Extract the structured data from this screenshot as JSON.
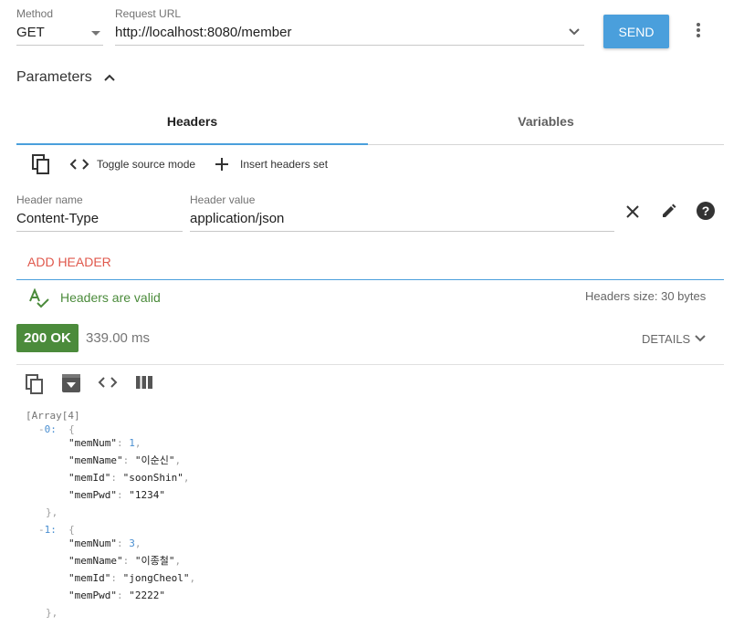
{
  "request": {
    "method_label": "Method",
    "method_value": "GET",
    "url_label": "Request URL",
    "url_value": "http://localhost:8080/member",
    "send_label": "SEND"
  },
  "parameters": {
    "title": "Parameters",
    "tabs": [
      {
        "label": "Headers",
        "active": true
      },
      {
        "label": "Variables",
        "active": false
      }
    ],
    "toolbar": {
      "toggle_label": "Toggle source mode",
      "insert_label": "Insert headers set"
    },
    "header": {
      "name_label": "Header name",
      "name_value": "Content-Type",
      "value_label": "Header value",
      "value_value": "application/json"
    },
    "add_header_label": "ADD HEADER",
    "valid_text": "Headers are valid",
    "size_text": "Headers size: 30 bytes"
  },
  "response": {
    "status": "200 OK",
    "time": "339.00 ms",
    "details_label": "DETAILS",
    "json": {
      "root": "[Array[4]",
      "items": [
        {
          "index": "0",
          "fields": [
            {
              "key": "\"memNum\"",
              "value": "1",
              "type": "num"
            },
            {
              "key": "\"memName\"",
              "value": "\"이순신\"",
              "type": "str"
            },
            {
              "key": "\"memId\"",
              "value": "\"soonShin\"",
              "type": "str"
            },
            {
              "key": "\"memPwd\"",
              "value": "\"1234\"",
              "type": "str"
            }
          ]
        },
        {
          "index": "1",
          "fields": [
            {
              "key": "\"memNum\"",
              "value": "3",
              "type": "num"
            },
            {
              "key": "\"memName\"",
              "value": "\"이종철\"",
              "type": "str"
            },
            {
              "key": "\"memId\"",
              "value": "\"jongCheol\"",
              "type": "str"
            },
            {
              "key": "\"memPwd\"",
              "value": "\"2222\"",
              "type": "str"
            }
          ]
        }
      ]
    }
  },
  "colors": {
    "accent": "#4a9fdc",
    "success": "#4b8b3b",
    "error": "#e0584c"
  }
}
